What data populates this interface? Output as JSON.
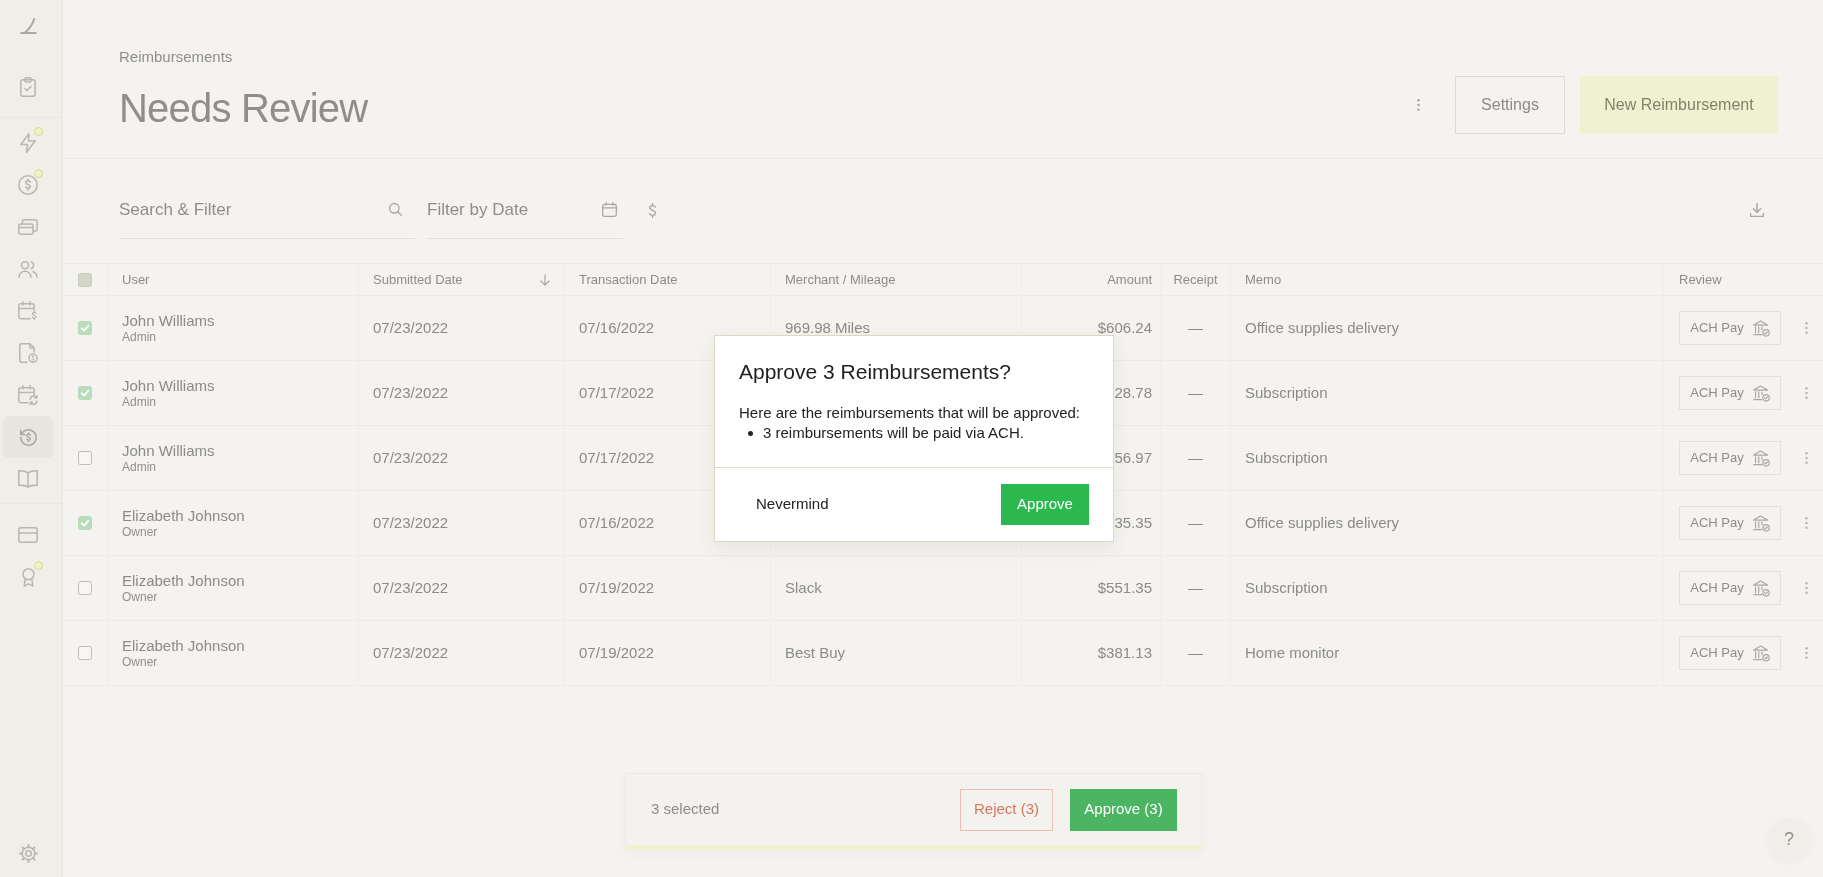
{
  "sidebar": {
    "groups": [
      {
        "items": [
          {
            "selected": false,
            "dot": false
          }
        ]
      },
      {
        "items": [
          {
            "selected": false,
            "dot": true
          },
          {
            "selected": false,
            "dot": true
          },
          {
            "selected": false,
            "dot": false
          },
          {
            "selected": false,
            "dot": false
          },
          {
            "selected": false,
            "dot": false
          },
          {
            "selected": false,
            "dot": false
          },
          {
            "selected": false,
            "dot": false
          },
          {
            "selected": true,
            "dot": false
          },
          {
            "selected": false,
            "dot": false
          }
        ]
      },
      {
        "items": [
          {
            "selected": false,
            "dot": false
          },
          {
            "selected": false,
            "dot": true
          }
        ]
      }
    ]
  },
  "header": {
    "breadcrumb": "Reimbursements",
    "title": "Needs Review",
    "buttons": [
      {
        "label": "Settings",
        "kind": "settings"
      },
      {
        "label": "New Reimbursement",
        "kind": "create"
      }
    ]
  },
  "filters": {
    "search": {
      "placeholder": "Search & Filter"
    },
    "date": {
      "placeholder": "Filter by Date"
    }
  },
  "table": {
    "select_all": {
      "indeterminate": true
    },
    "columns": [
      {
        "label": "User",
        "sorted": false
      },
      {
        "label": "Submitted Date",
        "sorted": true
      },
      {
        "label": "Transaction Date",
        "sorted": false
      },
      {
        "label": "Merchant / Mileage",
        "sorted": false
      },
      {
        "label": "Amount",
        "sorted": false
      },
      {
        "label": "Receipt",
        "sorted": false
      },
      {
        "label": "Memo",
        "sorted": false
      },
      {
        "label": "Review",
        "sorted": false
      }
    ],
    "rows": [
      {
        "checked": true,
        "user": "John Williams",
        "role": "Admin",
        "submitted_date": "07/23/2022",
        "transaction_date": "07/16/2022",
        "merchant": "969.98 Miles",
        "amount": "$606.24",
        "receipt": "—",
        "memo": "Office supplies delivery",
        "review_action": "ACH Pay"
      },
      {
        "checked": true,
        "user": "John Williams",
        "role": "Admin",
        "submitted_date": "07/23/2022",
        "transaction_date": "07/17/2022",
        "amount": "28.78",
        "receipt": "—",
        "memo": "Subscription",
        "review_action": "ACH Pay"
      },
      {
        "checked": false,
        "user": "John Williams",
        "role": "Admin",
        "submitted_date": "07/23/2022",
        "transaction_date": "07/17/2022",
        "amount": "56.97",
        "receipt": "—",
        "memo": "Subscription",
        "review_action": "ACH Pay"
      },
      {
        "checked": true,
        "user": "Elizabeth Johnson",
        "role": "Owner",
        "submitted_date": "07/23/2022",
        "transaction_date": "07/16/2022",
        "amount": "35.35",
        "receipt": "—",
        "memo": "Office supplies delivery",
        "review_action": "ACH Pay"
      },
      {
        "checked": false,
        "user": "Elizabeth Johnson",
        "role": "Owner",
        "submitted_date": "07/23/2022",
        "transaction_date": "07/19/2022",
        "merchant": "Slack",
        "amount": "$551.35",
        "receipt": "—",
        "memo": "Subscription",
        "review_action": "ACH Pay"
      },
      {
        "checked": false,
        "user": "Elizabeth Johnson",
        "role": "Owner",
        "submitted_date": "07/23/2022",
        "transaction_date": "07/19/2022",
        "merchant": "Best Buy",
        "amount": "$381.13",
        "receipt": "—",
        "memo": "Home monitor",
        "review_action": "ACH Pay"
      }
    ]
  },
  "bulk_bar": {
    "count": "3 selected",
    "buttons": [
      {
        "label": "Reject (3)",
        "kind": "reject"
      },
      {
        "label": "Approve (3)",
        "kind": "approve"
      }
    ]
  },
  "dialog": {
    "title": "Approve 3 Reimbursements?",
    "intro": "Here are the reimbursements that will be approved:",
    "items": [
      "3 reimbursements will be paid via ACH."
    ],
    "buttons": [
      {
        "label": "Nevermind",
        "kind": "cancel"
      },
      {
        "label": "Approve",
        "kind": "confirm"
      }
    ]
  },
  "help_button": {
    "label": "?"
  }
}
